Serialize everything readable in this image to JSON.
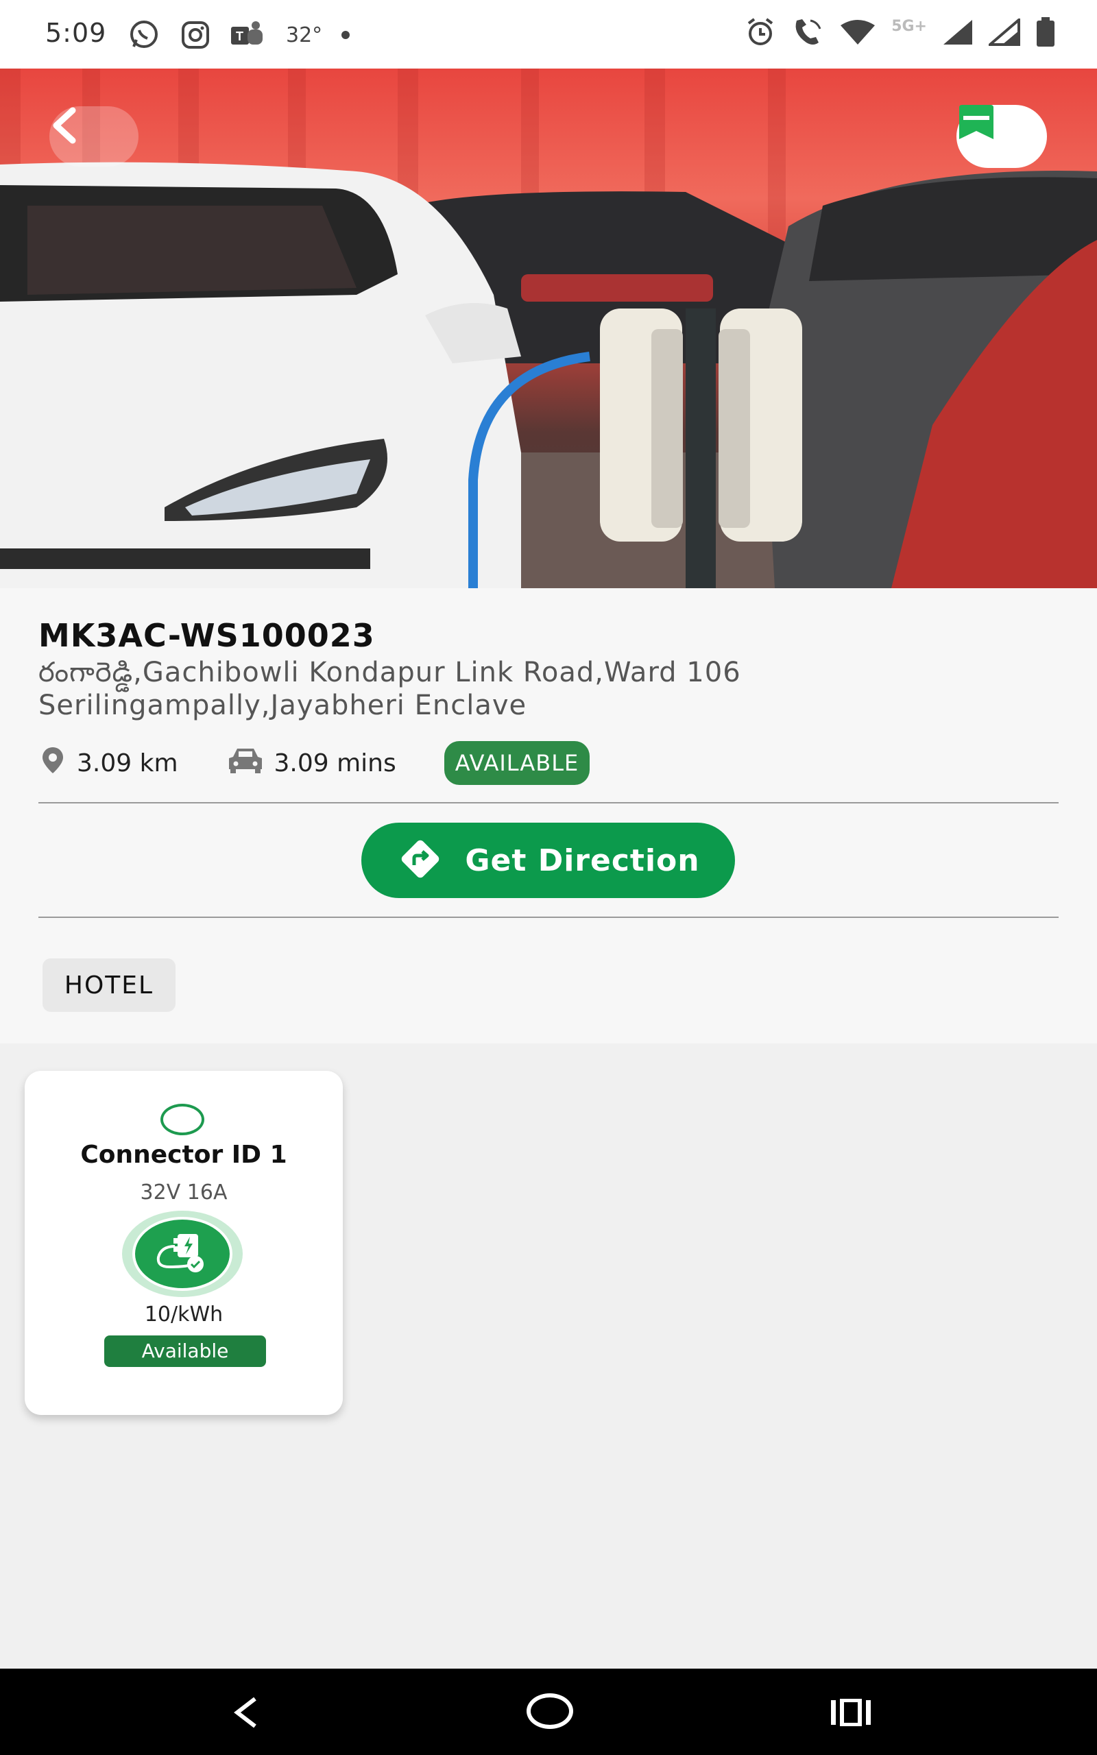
{
  "status_bar": {
    "time": "5:09",
    "temperature": "32°",
    "network_label": "5G+",
    "left_icons": [
      "whatsapp-icon",
      "instagram-icon",
      "teams-icon"
    ],
    "right_icons": [
      "alarm-icon",
      "wifi-call-icon",
      "wifi-icon",
      "signal-icon",
      "signal-icon",
      "battery-icon"
    ]
  },
  "header": {
    "back_icon": "chevron-left-icon",
    "bookmark_icon": "bookmark-icon"
  },
  "station": {
    "id": "MK3AC-WS100023",
    "address_line1": "రంగారెడ్డి,Gachibowli Kondapur Link Road,Ward 106",
    "address_line2": "Serilingampally,Jayabheri Enclave",
    "distance": "3.09 km",
    "duration": "3.09 mins",
    "status": "AVAILABLE"
  },
  "actions": {
    "get_direction_label": "Get Direction"
  },
  "tags": [
    "HOTEL"
  ],
  "connectors": [
    {
      "title": "Connector ID 1",
      "spec": "32V 16A",
      "price": "10/kWh",
      "status": "Available"
    }
  ],
  "colors": {
    "primary_green": "#0c9a4c",
    "badge_green": "#2e8b47",
    "status_green": "#1f7f3f"
  }
}
